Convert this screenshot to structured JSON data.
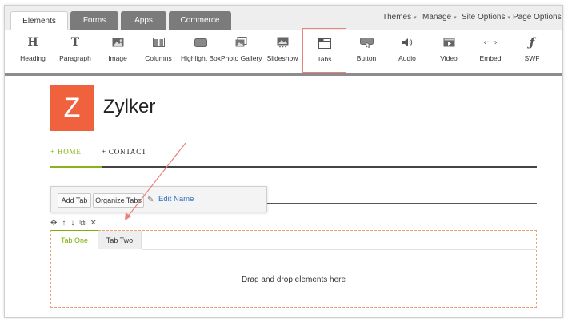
{
  "topbar": {
    "tabs": [
      {
        "label": "Elements",
        "active": true
      },
      {
        "label": "Forms",
        "active": false
      },
      {
        "label": "Apps",
        "active": false
      },
      {
        "label": "Commerce",
        "active": false
      }
    ],
    "menus": [
      "Themes",
      "Manage",
      "Site Options",
      "Page Options"
    ]
  },
  "toolbar": {
    "items": [
      {
        "label": "Heading",
        "icon": "heading-icon"
      },
      {
        "label": "Paragraph",
        "icon": "paragraph-icon"
      },
      {
        "label": "Image",
        "icon": "image-icon"
      },
      {
        "label": "Columns",
        "icon": "columns-icon"
      },
      {
        "label": "Highlight Box",
        "icon": "highlight-box-icon"
      },
      {
        "label": "Photo Gallery",
        "icon": "photo-gallery-icon"
      },
      {
        "label": "Slideshow",
        "icon": "slideshow-icon"
      },
      {
        "label": "Tabs",
        "icon": "tabs-icon",
        "selected": true
      },
      {
        "label": "Button",
        "icon": "button-icon"
      },
      {
        "label": "Audio",
        "icon": "audio-icon"
      },
      {
        "label": "Video",
        "icon": "video-icon"
      },
      {
        "label": "Embed",
        "icon": "embed-icon"
      },
      {
        "label": "SWF",
        "icon": "swf-icon"
      }
    ],
    "glyphs": {
      "heading": "H",
      "paragraph": "T",
      "embed": "‹···›",
      "swf": "ƒ"
    }
  },
  "site": {
    "logo_letter": "Z",
    "name": "Zylker",
    "nav": {
      "home": "+ HOME",
      "contact": "+ CONTACT"
    }
  },
  "popover": {
    "add_tab": "Add Tab",
    "organize_tabs": "Organize Tabs",
    "edit_name": "Edit Name"
  },
  "tabs_element": {
    "tabs": [
      "Tab One",
      "Tab Two"
    ],
    "placeholder": "Drag and drop elements here"
  },
  "colors": {
    "accent_green": "#7bb000",
    "logo_orange": "#f0623e",
    "link_blue": "#2a6fbf",
    "selection_red": "#e7837a",
    "dashed_orange": "#f0a070"
  }
}
